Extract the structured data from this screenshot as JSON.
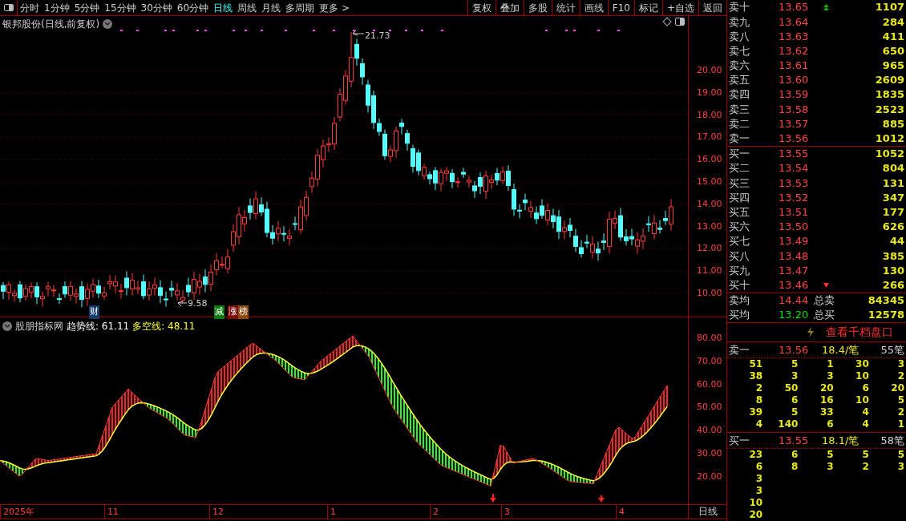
{
  "period_tabs": [
    {
      "label": "分时",
      "selected": false
    },
    {
      "label": "1分钟",
      "selected": false
    },
    {
      "label": "5分钟",
      "selected": false
    },
    {
      "label": "15分钟",
      "selected": false
    },
    {
      "label": "30分钟",
      "selected": false
    },
    {
      "label": "60分钟",
      "selected": false
    },
    {
      "label": "日线",
      "selected": true
    },
    {
      "label": "周线",
      "selected": false
    },
    {
      "label": "月线",
      "selected": false
    },
    {
      "label": "多周期",
      "selected": false
    },
    {
      "label": "更多 >",
      "selected": false
    }
  ],
  "tool_buttons": [
    "复权",
    "叠加",
    "多股",
    "统计",
    "画线",
    "F10",
    "标记",
    "+自选",
    "返回"
  ],
  "chart": {
    "title": "银邦股份(日线,前复权)",
    "high_label": "21.73",
    "low_label": "9.58",
    "price_axis": [
      "20.00",
      "19.00",
      "18.00",
      "17.00",
      "16.00",
      "15.00",
      "14.00",
      "13.00",
      "12.00",
      "11.00",
      "10.00"
    ],
    "badges": [
      {
        "text": "财",
        "color": "#163c6c"
      },
      {
        "text": "减",
        "color": "#0e7a0e"
      },
      {
        "text": "涨",
        "color": "#7a0e0e"
      },
      {
        "text": "榜",
        "color": "#8a4a10"
      }
    ]
  },
  "indicator": {
    "name": "股朋指标网",
    "trend_label": "趋势线: 61.11",
    "long_short_label": "多空线: 48.11",
    "axis": [
      "80.00",
      "70.00",
      "60.00",
      "50.00",
      "40.00",
      "30.00",
      "20.00"
    ]
  },
  "time_axis": {
    "labels": [
      "2025年",
      "11",
      "12",
      "1",
      "2",
      "3",
      "4"
    ],
    "period": "日线"
  },
  "order_book": {
    "asks": [
      {
        "label": "卖十",
        "price": "13.65",
        "volume": "1107",
        "kind": "rising"
      },
      {
        "label": "卖九",
        "price": "13.64",
        "volume": "284"
      },
      {
        "label": "卖八",
        "price": "13.63",
        "volume": "411"
      },
      {
        "label": "卖七",
        "price": "13.62",
        "volume": "650"
      },
      {
        "label": "卖六",
        "price": "13.61",
        "volume": "965"
      },
      {
        "label": "卖五",
        "price": "13.60",
        "volume": "2609"
      },
      {
        "label": "卖四",
        "price": "13.59",
        "volume": "1835"
      },
      {
        "label": "卖三",
        "price": "13.58",
        "volume": "2523"
      },
      {
        "label": "卖二",
        "price": "13.57",
        "volume": "885"
      },
      {
        "label": "卖一",
        "price": "13.56",
        "volume": "1012"
      }
    ],
    "bids": [
      {
        "label": "买一",
        "price": "13.55",
        "volume": "1052"
      },
      {
        "label": "买二",
        "price": "13.54",
        "volume": "804"
      },
      {
        "label": "买三",
        "price": "13.53",
        "volume": "131"
      },
      {
        "label": "买四",
        "price": "13.52",
        "volume": "347"
      },
      {
        "label": "买五",
        "price": "13.51",
        "volume": "177"
      },
      {
        "label": "买六",
        "price": "13.50",
        "volume": "626"
      },
      {
        "label": "买七",
        "price": "13.49",
        "volume": "44"
      },
      {
        "label": "买八",
        "price": "13.48",
        "volume": "385"
      },
      {
        "label": "买九",
        "price": "13.47",
        "volume": "130"
      },
      {
        "label": "买十",
        "price": "13.46",
        "volume": "266",
        "kind": "falling"
      }
    ],
    "summary": [
      {
        "label": "卖均",
        "price": "14.44",
        "color": "#ff4444",
        "total_label": "总卖",
        "total": "84345"
      },
      {
        "label": "买均",
        "price": "13.20",
        "color": "#00e000",
        "total_label": "总买",
        "total": "12578"
      }
    ],
    "queue_button": "查看千档盘口",
    "queues": [
      {
        "label": "卖一",
        "price": "13.56",
        "average": "18.4/笔",
        "count": "55笔",
        "rows": [
          [
            "51",
            "5",
            "1",
            "30",
            "3"
          ],
          [
            "38",
            "3",
            "3",
            "10",
            "2"
          ],
          [
            "2",
            "50",
            "20",
            "6",
            "20"
          ],
          [
            "8",
            "6",
            "16",
            "10",
            "5"
          ],
          [
            "39",
            "5",
            "33",
            "4",
            "2"
          ],
          [
            "4",
            "140",
            "6",
            "4",
            "1"
          ]
        ]
      },
      {
        "label": "买一",
        "price": "13.55",
        "average": "18.1/笔",
        "count": "58笔",
        "rows": [
          [
            "23",
            "6",
            "5",
            "5",
            "5"
          ],
          [
            "6",
            "8",
            "3",
            "2",
            "3"
          ],
          [
            "3"
          ],
          [
            "3"
          ],
          [
            "10"
          ],
          [
            "20"
          ]
        ]
      }
    ]
  }
}
